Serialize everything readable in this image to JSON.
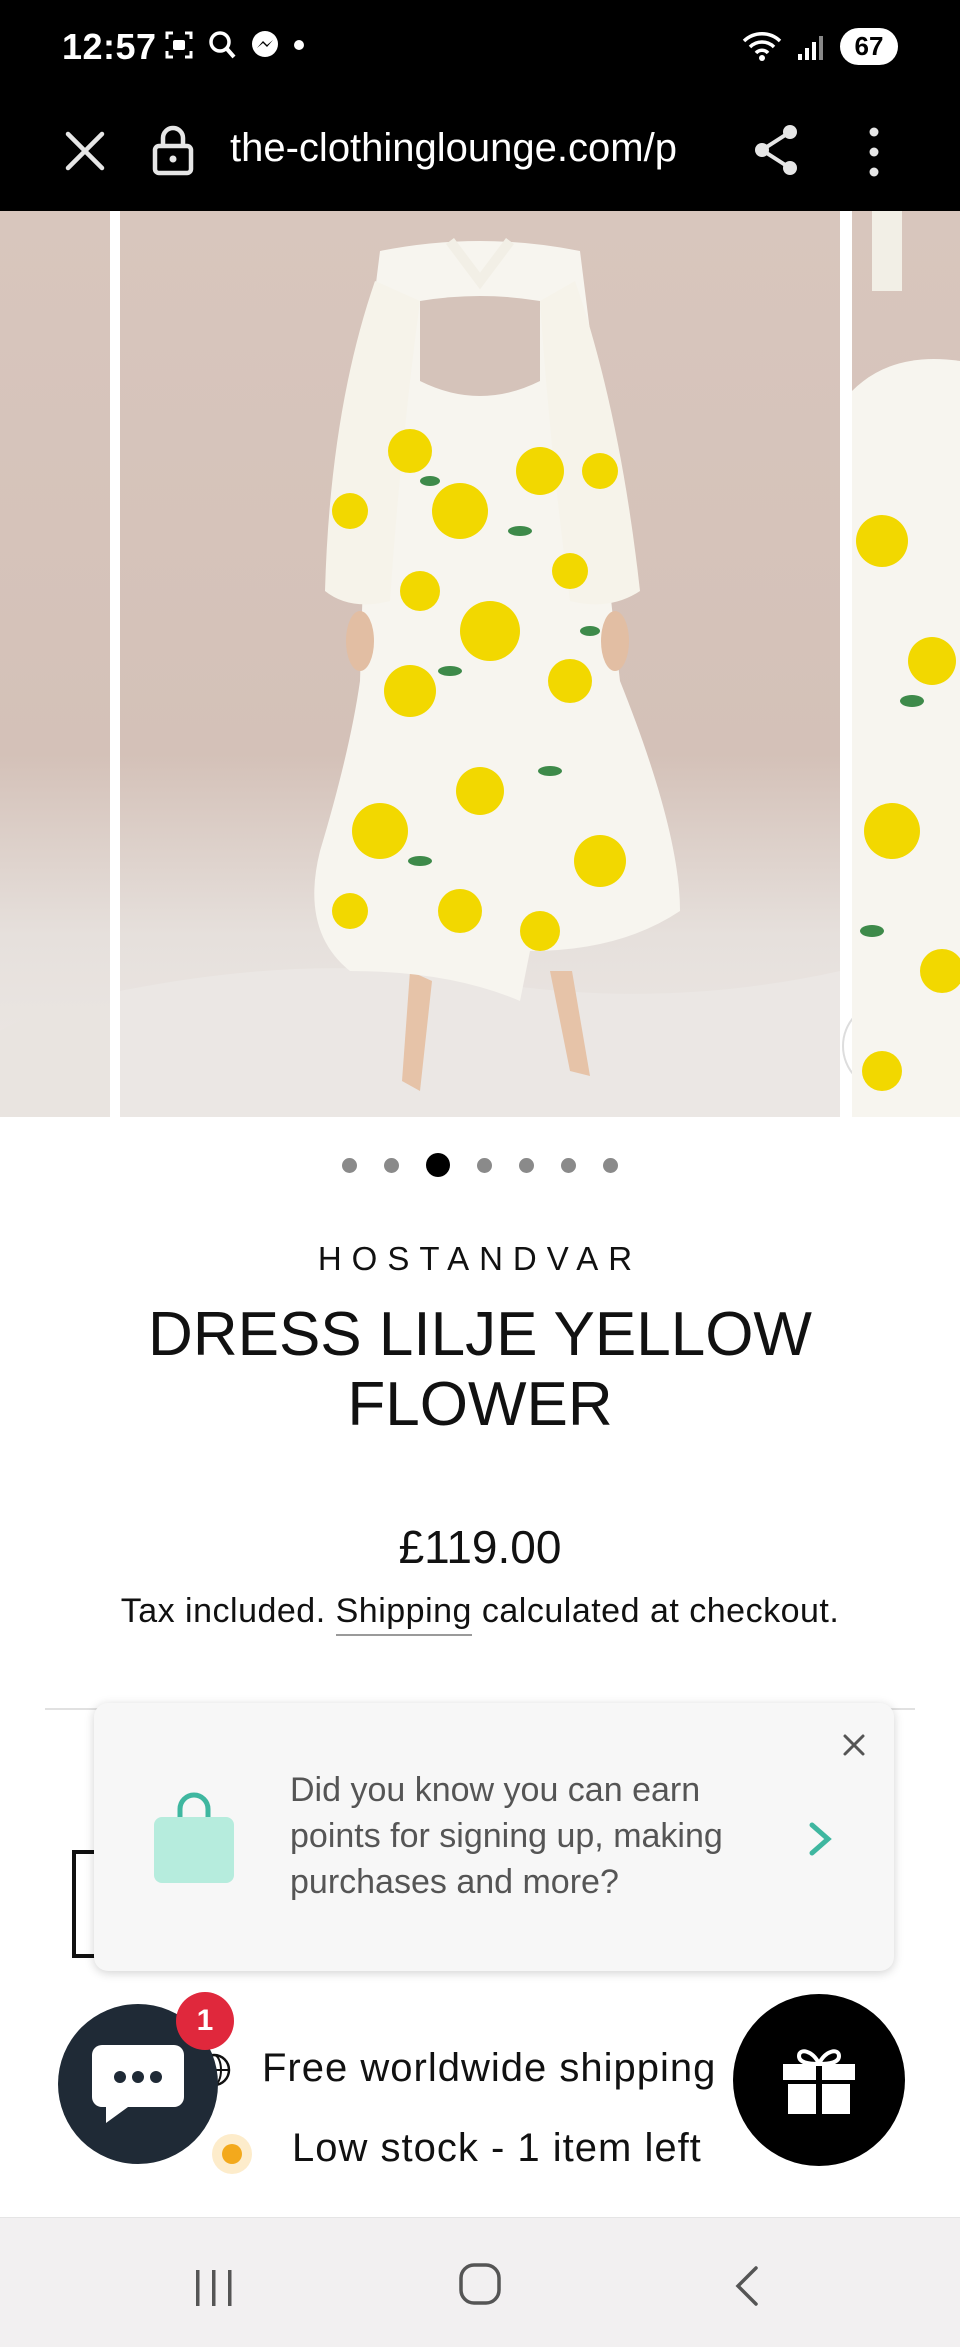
{
  "status_bar": {
    "time": "12:57",
    "battery": "67"
  },
  "browser": {
    "url": "the-clothinglounge.com/p"
  },
  "gallery": {
    "image_count": 7,
    "active_index": 2,
    "image_alt": "Model wearing yellow flower print dress, back view"
  },
  "product": {
    "vendor": "HOSTANDVAR",
    "title": "DRESS LILJE YELLOW FLOWER",
    "price": "£119.00",
    "tax_prefix": "Tax included. ",
    "shipping_link": "Shipping",
    "tax_suffix": " calculated at checkout."
  },
  "rewards_popup": {
    "message": "Did you know you can earn points for signing up, making purchases and more?"
  },
  "info": {
    "shipping": "Free worldwide shipping",
    "stock": "Low stock - 1 item left"
  },
  "chat": {
    "badge": "1"
  },
  "colors": {
    "accent_teal": "#3fb7a0",
    "bag_mint": "#b6ecdd",
    "badge_red": "#e0283c",
    "stock_orange": "#f3a91c",
    "chat_bg": "#1f2a36"
  }
}
